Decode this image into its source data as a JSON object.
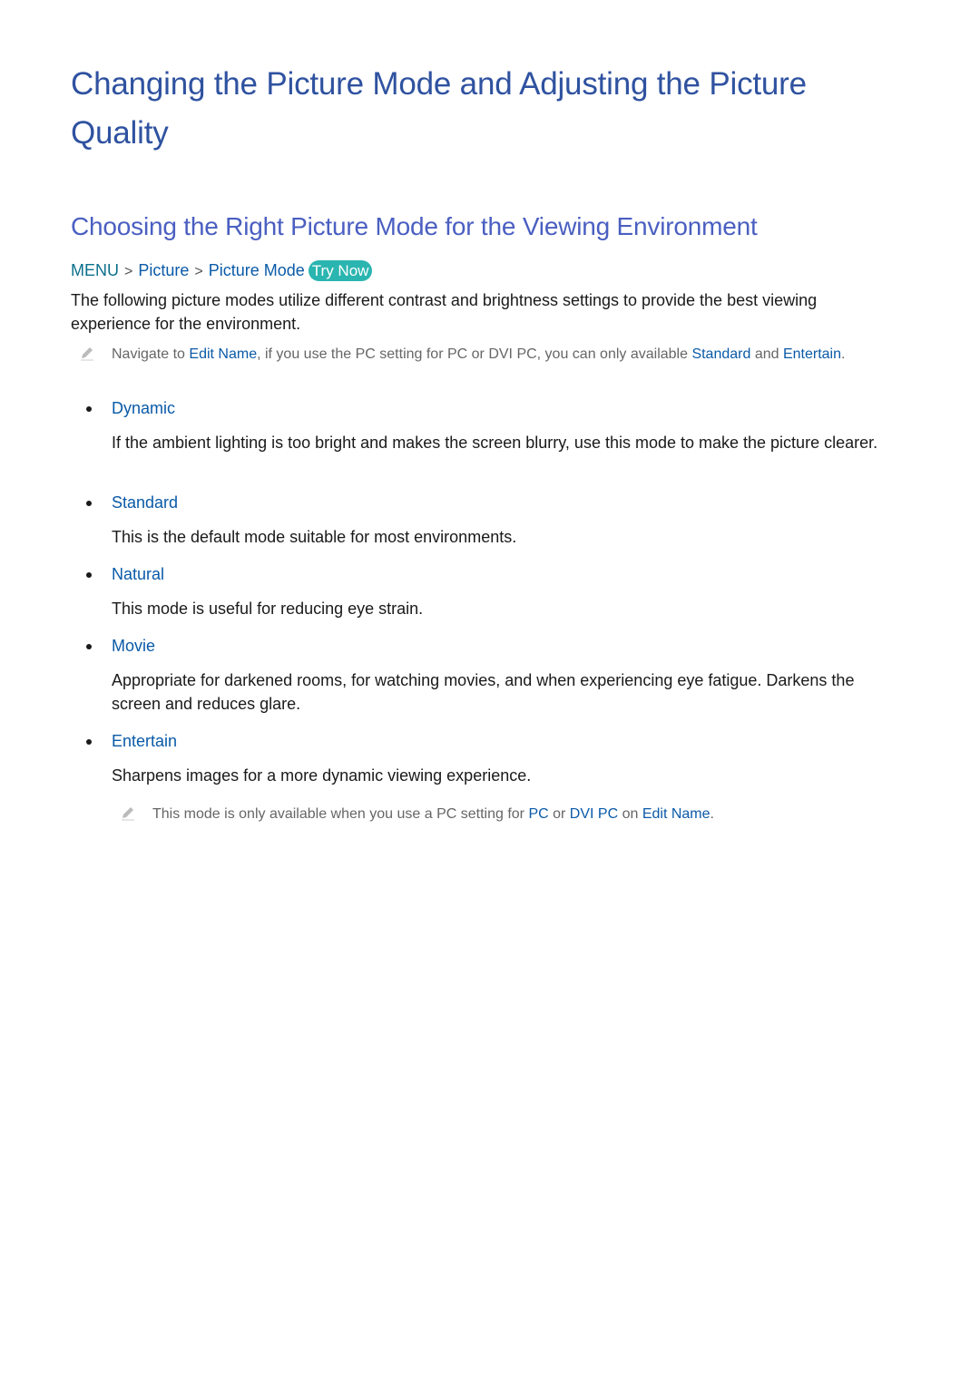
{
  "title": "Changing the Picture Mode and Adjusting the Picture Quality",
  "subtitle": "Choosing the Right Picture Mode for the Viewing Environment",
  "breadcrumb": {
    "items": [
      "MENU",
      "Picture",
      "Picture Mode"
    ],
    "separator": ">",
    "try_now": "Try Now"
  },
  "intro": "The following picture modes utilize different contrast and brightness settings to provide the best viewing experience for the environment.",
  "note1": {
    "icon": "pencil-icon",
    "parts": [
      "Navigate to ",
      "Edit Name",
      ", if you use the PC setting for PC or DVI PC, you can only available ",
      "Standard",
      " and ",
      "Entertain",
      "."
    ]
  },
  "modes": [
    {
      "name": "Dynamic",
      "description": "If the ambient lighting is too bright and makes the screen blurry, use this mode to make the picture clearer."
    },
    {
      "name": "Standard",
      "description": "This is the default mode suitable for most environments."
    },
    {
      "name": "Natural",
      "description": "This mode is useful for reducing eye strain."
    },
    {
      "name": "Movie",
      "description": "Appropriate for darkened rooms, for watching movies, and when experiencing eye fatigue. Darkens the screen and reduces glare."
    },
    {
      "name": "Entertain",
      "description": "Sharpens images for a more dynamic viewing experience."
    }
  ],
  "note2": {
    "icon": "pencil-icon",
    "parts": [
      "This mode is only available when you use a PC setting for ",
      "PC",
      " or ",
      "DVI PC",
      " on ",
      "Edit Name",
      "."
    ]
  },
  "colors": {
    "title": "#2f52a0",
    "subtitle": "#4a5fc1",
    "link": "#0a5aa8",
    "try_now_bg": "#2bb5b0"
  }
}
